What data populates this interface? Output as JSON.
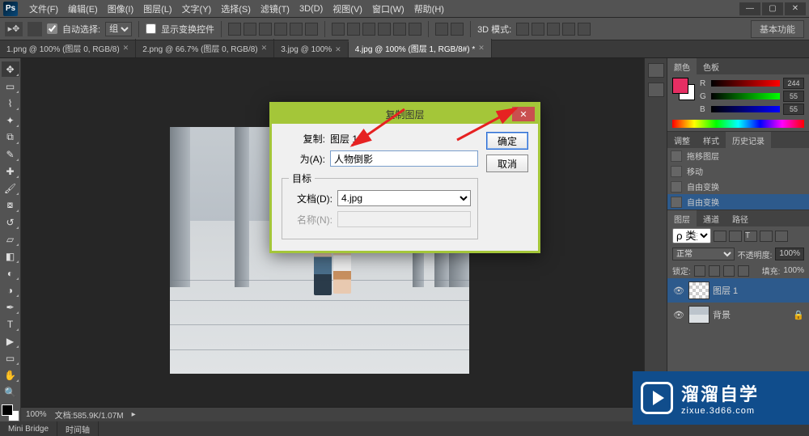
{
  "menubar": {
    "logo": "Ps",
    "items": [
      "文件(F)",
      "编辑(E)",
      "图像(I)",
      "图层(L)",
      "文字(Y)",
      "选择(S)",
      "滤镜(T)",
      "3D(D)",
      "视图(V)",
      "窗口(W)",
      "帮助(H)"
    ]
  },
  "windowControls": {
    "min": "—",
    "max": "▢",
    "close": "✕"
  },
  "optionsbar": {
    "autoSelectLabel": "自动选择:",
    "autoSelectValue": "组",
    "showTransformLabel": "显示变换控件",
    "mode3dLabel": "3D 模式:",
    "workspace": "基本功能"
  },
  "doctabs": [
    {
      "label": "1.png @ 100% (图层 0, RGB/8)",
      "active": false
    },
    {
      "label": "2.png @ 66.7% (图层 0, RGB/8)",
      "active": false
    },
    {
      "label": "3.jpg @ 100%",
      "active": false
    },
    {
      "label": "4.jpg @ 100% (图层 1, RGB/8#) *",
      "active": true
    }
  ],
  "panels": {
    "color": {
      "tabs": [
        "颜色",
        "色板"
      ],
      "r": "244",
      "g": "55",
      "b": "55"
    },
    "adjust": {
      "tabs": [
        "调整",
        "样式",
        "历史记录"
      ],
      "items": [
        "拖移图层",
        "移动",
        "自由变换",
        "自由变换"
      ],
      "activeIndex": 3
    },
    "layers": {
      "tabs": [
        "图层",
        "通道",
        "路径"
      ],
      "blendMode": "正常",
      "opacityLabel": "不透明度:",
      "opacityValue": "100%",
      "lockLabel": "锁定:",
      "fillLabel": "填充:",
      "fillValue": "100%",
      "items": [
        {
          "name": "图层 1",
          "selected": true,
          "thumb": "checker"
        },
        {
          "name": "背景",
          "selected": false,
          "thumb": "img",
          "locked": true
        }
      ]
    }
  },
  "status": {
    "zoom": "100%",
    "docInfo": "文档:585.9K/1.07M"
  },
  "bottomTabs": [
    "Mini Bridge",
    "时间轴"
  ],
  "dialog": {
    "title": "复制图层",
    "copyLabel": "复制:",
    "copyValue": "图层 1",
    "asLabel": "为(A):",
    "asValue": "人物倒影",
    "destLegend": "目标",
    "docLabel": "文档(D):",
    "docValue": "4.jpg",
    "nameLabel": "名称(N):",
    "nameValue": "",
    "ok": "确定",
    "cancel": "取消"
  },
  "watermark": {
    "big": "溜溜自学",
    "small": "zixue.3d66.com"
  }
}
